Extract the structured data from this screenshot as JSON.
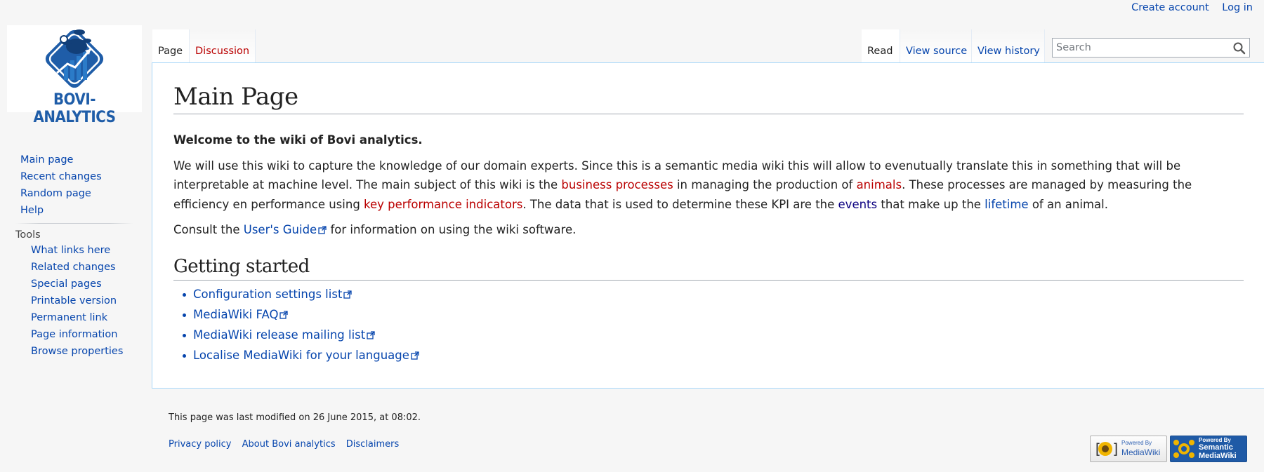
{
  "personal": {
    "create_account": "Create account",
    "log_in": "Log in"
  },
  "logo": {
    "text": "BOVI-ANALYTICS",
    "colors": {
      "primary": "#1f5da8",
      "accent": "#2b7bc8"
    }
  },
  "sidebar": {
    "nav_items": [
      {
        "label": "Main page"
      },
      {
        "label": "Recent changes"
      },
      {
        "label": "Random page"
      },
      {
        "label": "Help"
      }
    ],
    "tools_heading": "Tools",
    "tools_items": [
      {
        "label": "What links here"
      },
      {
        "label": "Related changes"
      },
      {
        "label": "Special pages"
      },
      {
        "label": "Printable version"
      },
      {
        "label": "Permanent link"
      },
      {
        "label": "Page information"
      },
      {
        "label": "Browse properties"
      }
    ]
  },
  "tabs": {
    "page": "Page",
    "discussion": "Discussion",
    "read": "Read",
    "view_source": "View source",
    "view_history": "View history"
  },
  "search": {
    "placeholder": "Search",
    "icon": "search-icon"
  },
  "content": {
    "title": "Main Page",
    "welcome": "Welcome to the wiki of Bovi analytics.",
    "p1_a": "We will use this wiki to capture the knowledge of our domain experts. Since this is a semantic media wiki this will allow to evenutually translate this in something that will be interpretable at machine level. The main subject of this wiki is the ",
    "p1_link_business": "business processes",
    "p1_b": " in managing the production of ",
    "p1_link_animals": "animals",
    "p1_c": ". These processes are managed by measuring the efficiency en performance using ",
    "p1_link_kpi": "key performance indicators",
    "p1_d": ". The data that is used to determine these KPI are the ",
    "p1_link_events": "events",
    "p1_e": " that make up the ",
    "p1_link_lifetime": "lifetime",
    "p1_f": " of an animal.",
    "p2_a": "Consult the ",
    "p2_link": "User's Guide",
    "p2_b": " for information on using the wiki software.",
    "getting_started": "Getting started",
    "gs_items": [
      {
        "label": "Configuration settings list"
      },
      {
        "label": "MediaWiki FAQ"
      },
      {
        "label": "MediaWiki release mailing list"
      },
      {
        "label": "Localise MediaWiki for your language"
      }
    ]
  },
  "footer": {
    "last_modified": "This page was last modified on 26 June 2015, at 08:02.",
    "links": [
      {
        "label": "Privacy policy"
      },
      {
        "label": "About Bovi analytics"
      },
      {
        "label": "Disclaimers"
      }
    ],
    "badge_mw": {
      "line1": "Powered By",
      "line2": "MediaWiki"
    },
    "badge_smw": {
      "line1": "Powered By",
      "line2": "Semantic",
      "line3": "MediaWiki"
    }
  },
  "colors": {
    "link": "#0645ad",
    "link_new": "#ba0000",
    "link_visited": "#0b0080",
    "border": "#a7d7f9",
    "background": "#f6f6f6"
  }
}
